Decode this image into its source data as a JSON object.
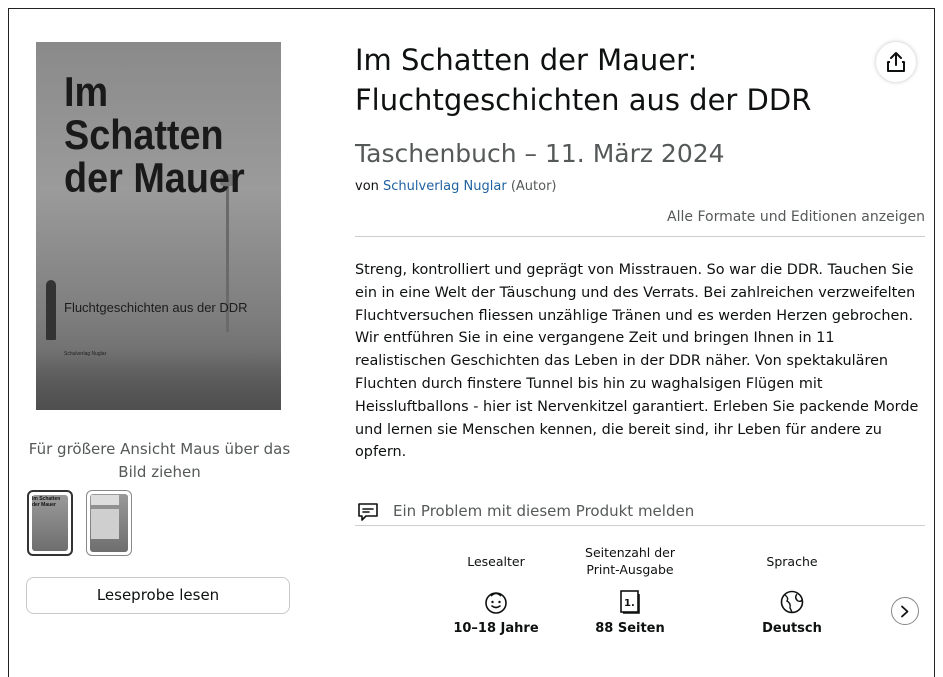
{
  "cover": {
    "title": "Im\nSchatten\nder Mauer",
    "subtitle": "Fluchtgeschichten aus der DDR",
    "author": "Schulverlag Nuglar"
  },
  "gallery": {
    "hover_hint": "Für größere Ansicht Maus über das Bild ziehen",
    "thumb1_text": "Im Schatten der Mauer",
    "read_sample": "Leseprobe lesen"
  },
  "product": {
    "title": "Im Schatten der Mauer: Fluchtgeschichten aus der DDR",
    "format": "Taschenbuch – 11. März 2024",
    "by_prefix": "von",
    "author": "Schulverlag Nuglar",
    "author_role": "(Autor)",
    "all_formats": "Alle Formate und Editionen anzeigen",
    "description": "Streng, kontrolliert und geprägt von Misstrauen. So war die DDR. Tauchen Sie ein in eine Welt der Täuschung und des Verrats. Bei zahlreichen verzweifelten Fluchtversuchen fliessen unzählige Tränen und es werden Herzen gebrochen. Wir entführen Sie in eine vergangene Zeit und bringen Ihnen in 11 realistischen Geschichten das Leben in der DDR näher. Von spektakulären Fluchten durch finstere Tunnel bis hin zu waghalsigen Flügen mit Heissluftballons - hier ist Nervenkitzel garantiert. Erleben Sie packende Morde und lernen sie Menschen kennen, die bereit sind, ihr Leben für andere zu opfern.",
    "report_link": "Ein Problem mit diesem Produkt melden"
  },
  "attributes": [
    {
      "label": "Lesealter",
      "value": "10–18 Jahre",
      "icon": "face-icon"
    },
    {
      "label": "Seitenzahl der Print-Ausgabe",
      "value": "88 Seiten",
      "icon": "page-icon"
    },
    {
      "label": "Sprache",
      "value": "Deutsch",
      "icon": "globe-icon"
    }
  ],
  "page_icon_glyph": "1."
}
